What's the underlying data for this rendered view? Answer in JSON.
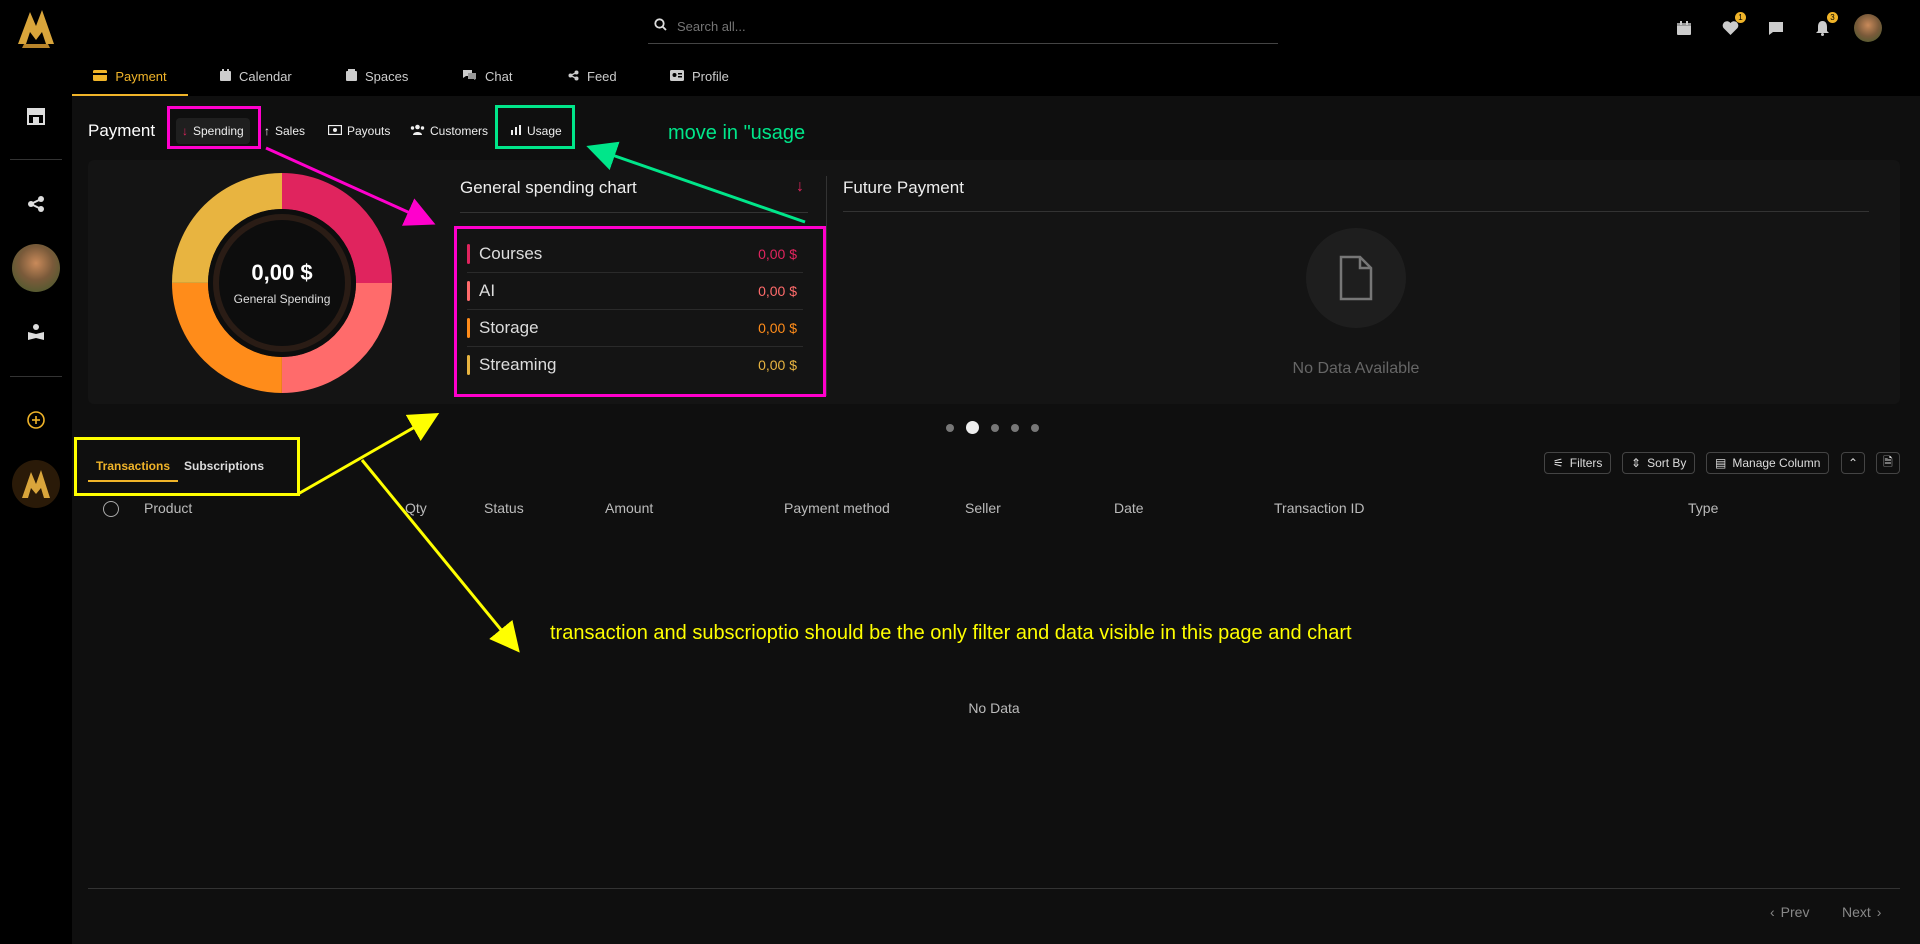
{
  "header": {
    "search_placeholder": "Search all...",
    "likes_badge": "1",
    "notifications_badge": "3"
  },
  "main_tabs": [
    {
      "label": "Payment",
      "icon": "credit-card-icon"
    },
    {
      "label": "Calendar",
      "icon": "calendar-icon"
    },
    {
      "label": "Spaces",
      "icon": "spaces-icon"
    },
    {
      "label": "Chat",
      "icon": "chat-icon"
    },
    {
      "label": "Feed",
      "icon": "share-icon"
    },
    {
      "label": "Profile",
      "icon": "id-card-icon"
    }
  ],
  "payment": {
    "title": "Payment",
    "sub_tabs": [
      {
        "label": "Spending",
        "icon": "arrow-down-icon"
      },
      {
        "label": "Sales",
        "icon": "arrow-up-icon"
      },
      {
        "label": "Payouts",
        "icon": "money-icon"
      },
      {
        "label": "Customers",
        "icon": "users-icon"
      },
      {
        "label": "Usage",
        "icon": "chart-icon"
      }
    ]
  },
  "donut": {
    "value": "0,00 $",
    "label": "General Spending",
    "colors": [
      "#e0245e",
      "#ff6b6b",
      "#ff8c1a",
      "#e8b440"
    ]
  },
  "spending_chart": {
    "title": "General spending chart",
    "items": [
      {
        "name": "Courses",
        "value": "0,00 $",
        "color": "#e0245e"
      },
      {
        "name": "AI",
        "value": "0,00 $",
        "color": "#ff6b6b"
      },
      {
        "name": "Storage",
        "value": "0,00 $",
        "color": "#ff8c1a"
      },
      {
        "name": "Streaming",
        "value": "0,00 $",
        "color": "#e8b440"
      }
    ]
  },
  "future_payment": {
    "title": "Future Payment",
    "empty": "No Data Available"
  },
  "table": {
    "tabs": [
      "Transactions",
      "Subscriptions"
    ],
    "actions": {
      "filters": "Filters",
      "sort": "Sort By",
      "manage": "Manage Column"
    },
    "columns": [
      "Product",
      "Qty",
      "Status",
      "Amount",
      "Payment method",
      "Seller",
      "Date",
      "Transaction ID",
      "Type"
    ],
    "empty": "No Data",
    "prev": "Prev",
    "next": "Next"
  },
  "annotations": {
    "usage_note": "move in \"usage",
    "filter_note": "transaction and subscrioptio should be the only filter and data visible in this page and chart"
  },
  "colors": {
    "accent": "#f0b429",
    "magenta": "#ff00cc",
    "green": "#00e68a",
    "yellow": "#ffff00"
  }
}
